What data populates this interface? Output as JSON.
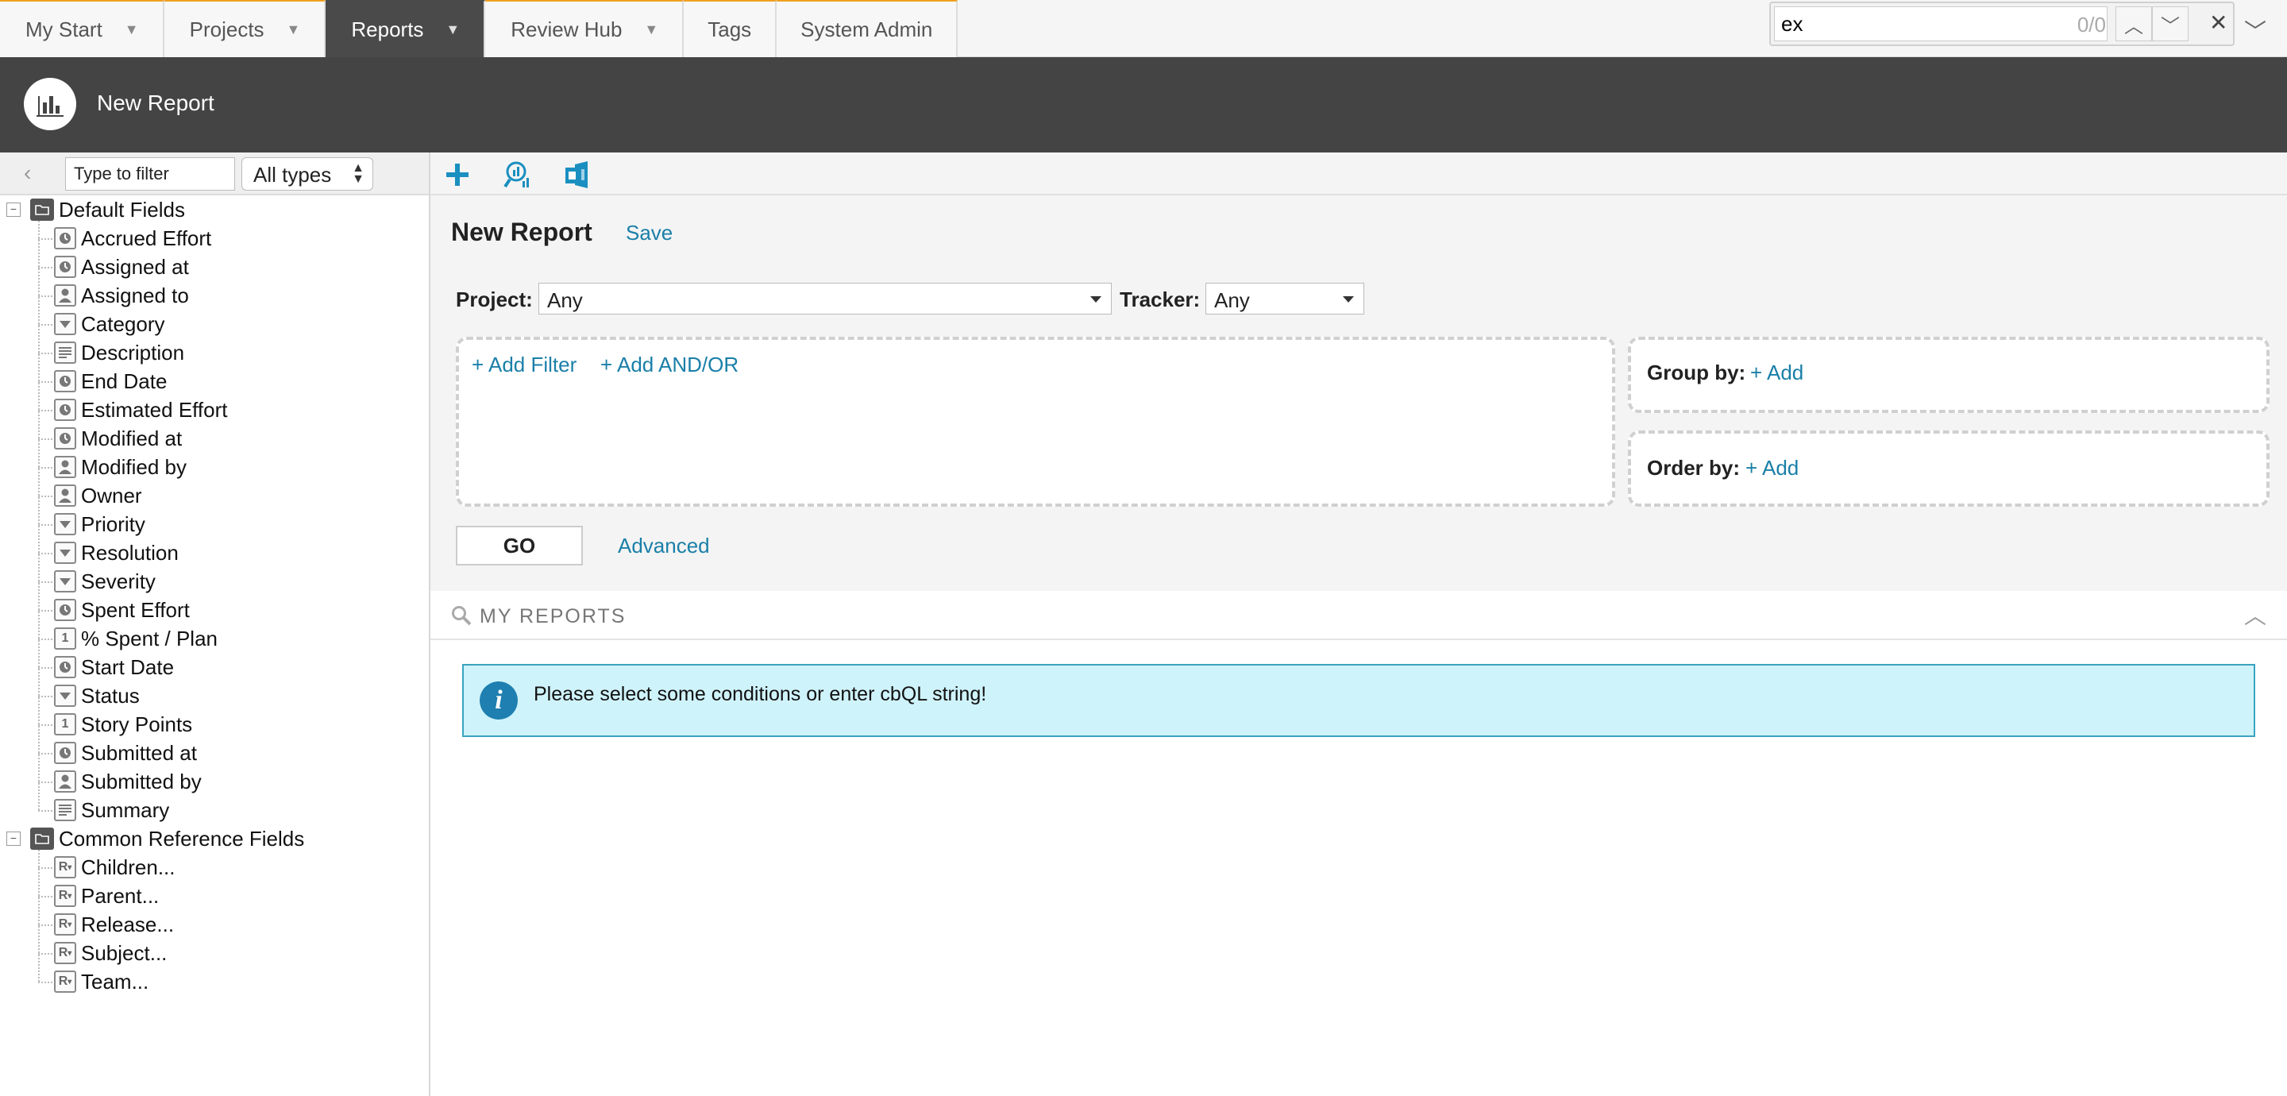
{
  "nav": {
    "tabs": [
      {
        "label": "My Start",
        "caret": "▼"
      },
      {
        "label": "Projects",
        "caret": "▼"
      },
      {
        "label": "Reports",
        "caret": "▼"
      },
      {
        "label": "Review Hub",
        "caret": "▼"
      },
      {
        "label": "Tags"
      },
      {
        "label": "System Admin"
      }
    ],
    "active_tab": "Reports",
    "accent_color": "#f0a020"
  },
  "find_bar": {
    "query": "ex",
    "count": "0/0",
    "prev": "︿",
    "next": "﹀",
    "close": "✕",
    "more": "﹀"
  },
  "header": {
    "title": "New Report",
    "icon": "bar-chart-icon"
  },
  "left_panel": {
    "back": "‹",
    "filter_placeholder": "Type to filter",
    "type_select": "All types",
    "groups": [
      {
        "label": "Default Fields",
        "toggle": "−",
        "items": [
          {
            "label": "Accrued Effort",
            "icon": "clock-icon"
          },
          {
            "label": "Assigned at",
            "icon": "clock-icon"
          },
          {
            "label": "Assigned to",
            "icon": "user-icon"
          },
          {
            "label": "Category",
            "icon": "dropdown-icon"
          },
          {
            "label": "Description",
            "icon": "text-icon"
          },
          {
            "label": "End Date",
            "icon": "clock-icon"
          },
          {
            "label": "Estimated Effort",
            "icon": "clock-icon"
          },
          {
            "label": "Modified at",
            "icon": "clock-icon"
          },
          {
            "label": "Modified by",
            "icon": "user-icon"
          },
          {
            "label": "Owner",
            "icon": "user-icon"
          },
          {
            "label": "Priority",
            "icon": "dropdown-icon"
          },
          {
            "label": "Resolution",
            "icon": "dropdown-icon"
          },
          {
            "label": "Severity",
            "icon": "dropdown-icon"
          },
          {
            "label": "Spent Effort",
            "icon": "clock-icon"
          },
          {
            "label": "% Spent / Plan",
            "icon": "number-icon"
          },
          {
            "label": "Start Date",
            "icon": "clock-icon"
          },
          {
            "label": "Status",
            "icon": "dropdown-icon"
          },
          {
            "label": "Story Points",
            "icon": "number-icon"
          },
          {
            "label": "Submitted at",
            "icon": "clock-icon"
          },
          {
            "label": "Submitted by",
            "icon": "user-icon"
          },
          {
            "label": "Summary",
            "icon": "text-icon"
          }
        ]
      },
      {
        "label": "Common Reference Fields",
        "toggle": "−",
        "items": [
          {
            "label": "Children...",
            "icon": "reference-icon"
          },
          {
            "label": "Parent...",
            "icon": "reference-icon"
          },
          {
            "label": "Release...",
            "icon": "reference-icon"
          },
          {
            "label": "Subject...",
            "icon": "reference-icon"
          },
          {
            "label": "Team...",
            "icon": "reference-icon"
          }
        ]
      }
    ],
    "glyphs": {
      "number-icon": "1",
      "reference-icon": "R"
    }
  },
  "toolbar": {
    "icons": [
      "plus-icon",
      "search-report-icon",
      "export-icon"
    ],
    "icon_color": "#1a8fc0"
  },
  "builder": {
    "title": "New Report",
    "save_label": "Save",
    "project_label": "Project:",
    "project_value": "Any",
    "tracker_label": "Tracker:",
    "tracker_value": "Any",
    "add_filter": "+ Add Filter",
    "add_and_or": "+ Add AND/OR",
    "group_by_label": "Group by:",
    "group_by_add": "+ Add",
    "order_by_label": "Order by:",
    "order_by_add": "+ Add",
    "go_label": "GO",
    "advanced_label": "Advanced",
    "link_color": "#1a7fa8"
  },
  "my_reports": {
    "label": "MY REPORTS",
    "collapse": "︿"
  },
  "info": {
    "message": "Please select some conditions or enter cbQL string!",
    "icon_glyph": "i"
  }
}
